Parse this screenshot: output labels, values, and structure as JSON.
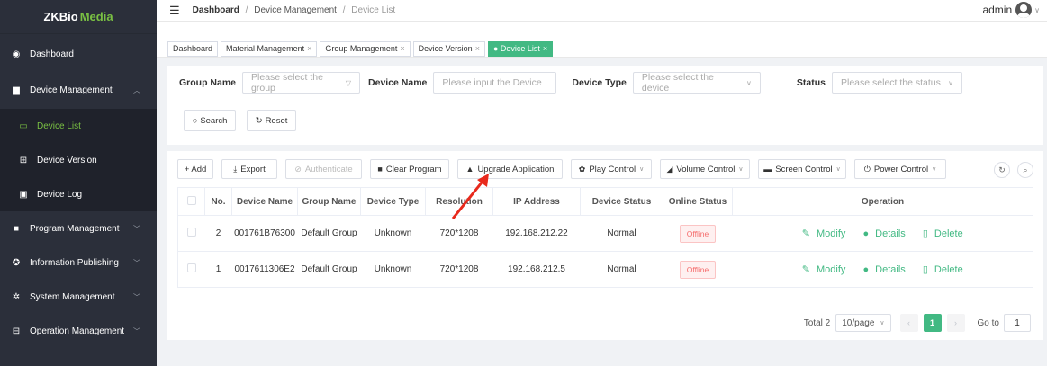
{
  "logo": {
    "prefix": "ZKBio",
    "suffix": "Media"
  },
  "sidebar": {
    "items": [
      {
        "label": "Dashboard",
        "icon": "dashboard-icon"
      },
      {
        "label": "Device Management",
        "icon": "monitor-icon"
      },
      {
        "label": "Device List",
        "icon": "list-icon"
      },
      {
        "label": "Device Version",
        "icon": "grid-icon"
      },
      {
        "label": "Device Log",
        "icon": "log-icon"
      },
      {
        "label": "Program Management",
        "icon": "folder-icon"
      },
      {
        "label": "Information Publishing",
        "icon": "publish-icon"
      },
      {
        "label": "System Management",
        "icon": "gear-icon"
      },
      {
        "label": "Operation Management",
        "icon": "operation-icon"
      }
    ]
  },
  "header": {
    "breadcrumb": [
      "Dashboard",
      "Device Management",
      "Device List"
    ],
    "user": "admin"
  },
  "tabs": [
    {
      "label": "Dashboard"
    },
    {
      "label": "Material Management"
    },
    {
      "label": "Group Management"
    },
    {
      "label": "Device Version"
    },
    {
      "label": "Device List"
    }
  ],
  "filters": {
    "group_label": "Group Name",
    "group_placeholder": "Please select the group",
    "device_name_label": "Device Name",
    "device_name_placeholder": "Please input the Device",
    "device_type_label": "Device Type",
    "device_type_placeholder": "Please select the device",
    "status_label": "Status",
    "status_placeholder": "Please select the status",
    "search": "Search",
    "reset": "Reset"
  },
  "toolbar": {
    "add": "+ Add",
    "export": "Export",
    "authenticate": "Authenticate",
    "clear_program": "Clear Program",
    "upgrade": "Upgrade Application",
    "play_control": "Play Control",
    "volume_control": "Volume Control",
    "screen_control": "Screen Control",
    "power_control": "Power Control"
  },
  "table": {
    "headers": [
      "No.",
      "Device Name",
      "Group Name",
      "Device Type",
      "Resolution",
      "IP Address",
      "Device Status",
      "Online Status",
      "Operation"
    ],
    "rows": [
      {
        "no": "2",
        "name": "001761B76300",
        "group": "Default Group",
        "type": "Unknown",
        "res": "720*1208",
        "ip": "192.168.212.22",
        "status": "Normal",
        "online": "Offline"
      },
      {
        "no": "1",
        "name": "0017611306E2",
        "group": "Default Group",
        "type": "Unknown",
        "res": "720*1208",
        "ip": "192.168.212.5",
        "status": "Normal",
        "online": "Offline"
      }
    ],
    "ops": {
      "modify": "Modify",
      "details": "Details",
      "delete": "Delete"
    }
  },
  "pager": {
    "total": "Total 2",
    "size": "10/page",
    "page": "1",
    "goto": "Go to",
    "goto_value": "1"
  },
  "colors": {
    "accent": "#42b983",
    "sidebar": "#2b2f3a",
    "offline": "#f56c6c",
    "annotation": "#e8291c"
  }
}
